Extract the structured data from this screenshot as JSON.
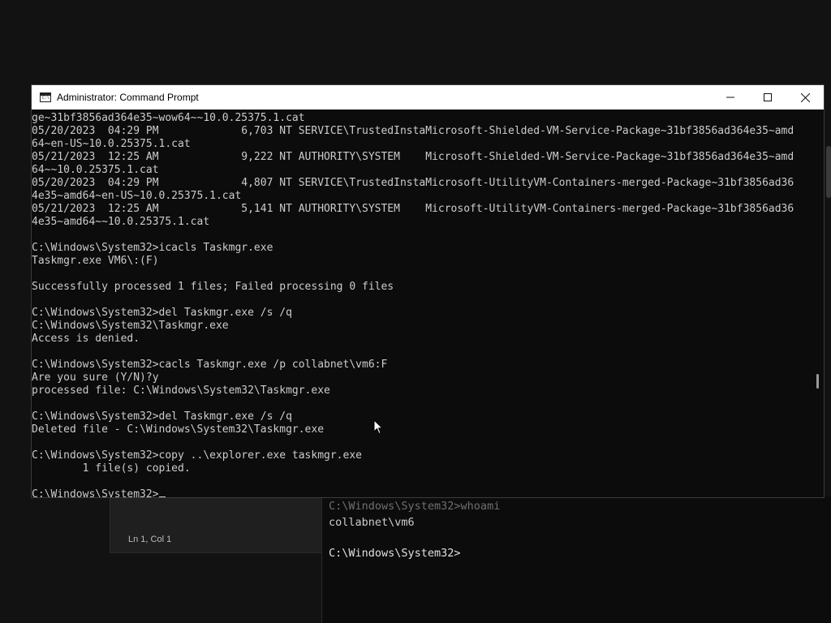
{
  "window": {
    "title": "Administrator: Command Prompt",
    "icon": "cmd-icon",
    "icon_text": "C:\\",
    "controls": [
      "minimize-icon",
      "maximize-icon",
      "close-icon"
    ]
  },
  "console": {
    "lines": [
      "ge~31bf3856ad364e35~wow64~~10.0.25375.1.cat",
      "05/20/2023  04:29 PM             6,703 NT SERVICE\\TrustedInstaMicrosoft-Shielded-VM-Service-Package~31bf3856ad364e35~amd",
      "64~en-US~10.0.25375.1.cat",
      "05/21/2023  12:25 AM             9,222 NT AUTHORITY\\SYSTEM    Microsoft-Shielded-VM-Service-Package~31bf3856ad364e35~amd",
      "64~~10.0.25375.1.cat",
      "05/20/2023  04:29 PM             4,807 NT SERVICE\\TrustedInstaMicrosoft-UtilityVM-Containers-merged-Package~31bf3856ad36",
      "4e35~amd64~en-US~10.0.25375.1.cat",
      "05/21/2023  12:25 AM             5,141 NT AUTHORITY\\SYSTEM    Microsoft-UtilityVM-Containers-merged-Package~31bf3856ad36",
      "4e35~amd64~~10.0.25375.1.cat",
      "",
      "C:\\Windows\\System32>icacls Taskmgr.exe",
      "Taskmgr.exe VM6\\:(F)",
      "",
      "Successfully processed 1 files; Failed processing 0 files",
      "",
      "C:\\Windows\\System32>del Taskmgr.exe /s /q",
      "C:\\Windows\\System32\\Taskmgr.exe",
      "Access is denied.",
      "",
      "C:\\Windows\\System32>cacls Taskmgr.exe /p collabnet\\vm6:F",
      "Are you sure (Y/N)?y",
      "processed file: C:\\Windows\\System32\\Taskmgr.exe",
      "",
      "C:\\Windows\\System32>del Taskmgr.exe /s /q",
      "Deleted file - C:\\Windows\\System32\\Taskmgr.exe",
      "",
      "C:\\Windows\\System32>copy ..\\explorer.exe taskmgr.exe",
      "        1 file(s) copied.",
      "",
      "C:\\Windows\\System32>"
    ]
  },
  "background": {
    "notepad_status": "Ln 1, Col 1",
    "terminal_lines": [
      "C:\\Windows\\System32>whoami",
      "collabnet\\vm6",
      "",
      "C:\\Windows\\System32>"
    ]
  },
  "colors": {
    "console_bg": "#0c0c0c",
    "console_fg": "#cccccc",
    "titlebar_bg": "#ffffff"
  }
}
